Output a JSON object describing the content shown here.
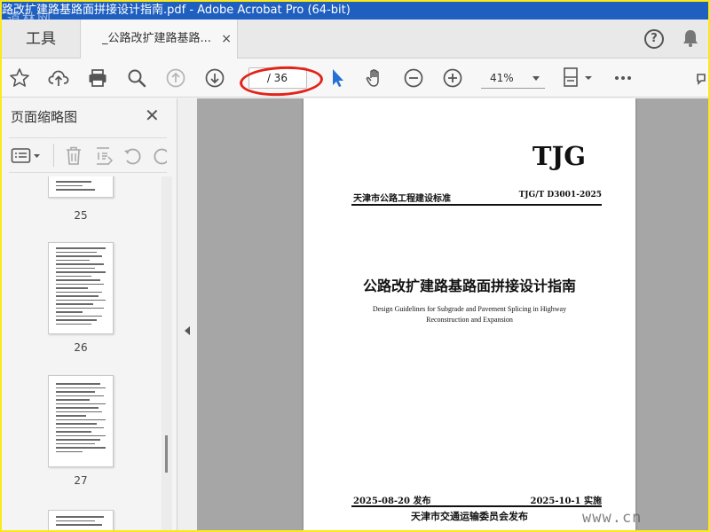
{
  "window": {
    "title": "路改扩建路基路面拼接设计指南.pdf - Adobe Acrobat Pro (64-bit)"
  },
  "watermark_top": "道林网",
  "watermark_bottom": "www.cn",
  "tabs": {
    "tools_label": "工具",
    "doc_label": "_公路改扩建路基路...",
    "close_glyph": "×"
  },
  "header_icons": {
    "help": "?",
    "help_icon": "help-circle-icon",
    "bell_icon": "bell-icon"
  },
  "toolbar": {
    "page_current": "",
    "page_total": "/ 36",
    "zoom": "41%"
  },
  "sidebar": {
    "title": "页面缩略图",
    "close_glyph": "✕",
    "pages": [
      {
        "num": "25"
      },
      {
        "num": "26"
      },
      {
        "num": "27"
      }
    ]
  },
  "document": {
    "mark": "TJG",
    "header_left": "天津市公路工程建设标准",
    "header_right": "TJG/T D3001-2025",
    "title": "公路改扩建路基路面拼接设计指南",
    "subtitle": "Design Guidelines for Subgrade and Pavement Splicing in Highway Reconstruction and Expansion",
    "publish_date": "2025-08-20 发布",
    "implement_date": "2025-10-1 实施",
    "publisher": "天津市交通运输委员会发布"
  },
  "colors": {
    "accent_blue": "#1f5fbf",
    "annotation_red": "#e2231a",
    "frame_yellow": "#fbe91a"
  }
}
